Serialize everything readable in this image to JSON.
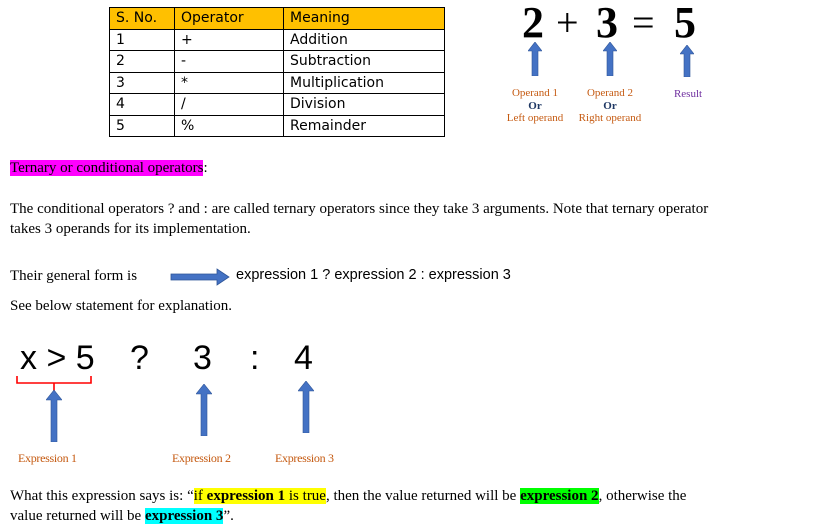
{
  "table": {
    "headers": [
      "S. No.",
      "Operator",
      "Meaning"
    ],
    "rows": [
      [
        "1",
        "+",
        "Addition"
      ],
      [
        "2",
        "-",
        "Subtraction"
      ],
      [
        "3",
        "*",
        "Multiplication"
      ],
      [
        "4",
        "/",
        "Division"
      ],
      [
        "5",
        "%",
        "Remainder"
      ]
    ],
    "header_color": "#ffc000"
  },
  "equation": {
    "operand1": "2",
    "plus": "+",
    "operand2": "3",
    "equals": "=",
    "result": "5",
    "label1_top": "Operand 1",
    "label1_or": "Or",
    "label1_bottom": "Left operand",
    "label2_top": "Operand 2",
    "label2_or": "Or",
    "label2_bottom": "Right operand",
    "label3": "Result"
  },
  "heading": {
    "text": "Ternary or conditional operators",
    "suffix": ":"
  },
  "intro": {
    "line1": "The conditional operators ? and : are called ternary operators since they take 3 arguments. Note that ternary operator",
    "line2": "takes 3 operands for its implementation."
  },
  "general_form": {
    "prefix": "Their general form is",
    "expression": "expression 1 ? expression 2 : expression 3"
  },
  "see_below": "See below statement for explanation.",
  "ternary_example": {
    "condition": "x > 5",
    "question": "?",
    "value_true": "3",
    "colon": ":",
    "value_false": "4",
    "label1": "Expression 1",
    "label2": "Expression 2",
    "label3": "Expression 3"
  },
  "explanation": {
    "p1": "What this expression says is: “",
    "if": "if ",
    "expr1": "expression 1",
    "is_true": " is true",
    "p2": ", then the value returned will be ",
    "expr2": "expression 2",
    "p3": ", otherwise the",
    "p4": "value returned will be ",
    "expr3": "expression 3",
    "p5": "”."
  },
  "colors": {
    "arrow_blue": "#4472c4",
    "label_orange": "#c55a11",
    "result_purple": "#7030a0",
    "brace_red": "#ff0000",
    "highlight_magenta": "#ff00ff",
    "highlight_yellow": "#ffff00",
    "highlight_green": "#00ff00",
    "highlight_cyan": "#00ffff"
  }
}
